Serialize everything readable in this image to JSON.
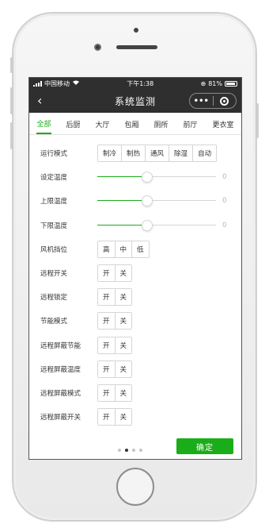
{
  "status_bar": {
    "carrier": "中国移动",
    "time": "下午1:38",
    "battery": "81%"
  },
  "navbar": {
    "back_icon": "chevron-left-icon",
    "title": "系统监测",
    "more_label": "•••"
  },
  "tabs": [
    {
      "label": "全部",
      "active": true
    },
    {
      "label": "后厨",
      "active": false
    },
    {
      "label": "大厅",
      "active": false
    },
    {
      "label": "包厢",
      "active": false
    },
    {
      "label": "厕所",
      "active": false
    },
    {
      "label": "前厅",
      "active": false
    },
    {
      "label": "更衣室",
      "active": false
    }
  ],
  "mode": {
    "label": "运行模式",
    "options": [
      "制冷",
      "制热",
      "通风",
      "除湿",
      "自动"
    ]
  },
  "sliders": [
    {
      "label": "设定温度",
      "value": "0",
      "level": 0.42
    },
    {
      "label": "上限温度",
      "value": "0",
      "level": 0.42
    },
    {
      "label": "下限温度",
      "value": "0",
      "level": 0.42
    }
  ],
  "fan": {
    "label": "风机挡位",
    "options": [
      "高",
      "中",
      "低"
    ]
  },
  "switches": [
    {
      "label": "远程开关",
      "on": "开",
      "off": "关"
    },
    {
      "label": "远程锁定",
      "on": "开",
      "off": "关"
    },
    {
      "label": "节能模式",
      "on": "开",
      "off": "关"
    },
    {
      "label": "远程屏蔽节能",
      "on": "开",
      "off": "关"
    },
    {
      "label": "远程屏蔽温度",
      "on": "开",
      "off": "关"
    },
    {
      "label": "远程屏蔽模式",
      "on": "开",
      "off": "关"
    },
    {
      "label": "远程屏蔽开关",
      "on": "开",
      "off": "关"
    }
  ],
  "pager": {
    "count": 4,
    "active_index": 1
  },
  "confirm_label": "确定",
  "colors": {
    "accent": "#1aad19",
    "header": "#2f2f2f"
  }
}
